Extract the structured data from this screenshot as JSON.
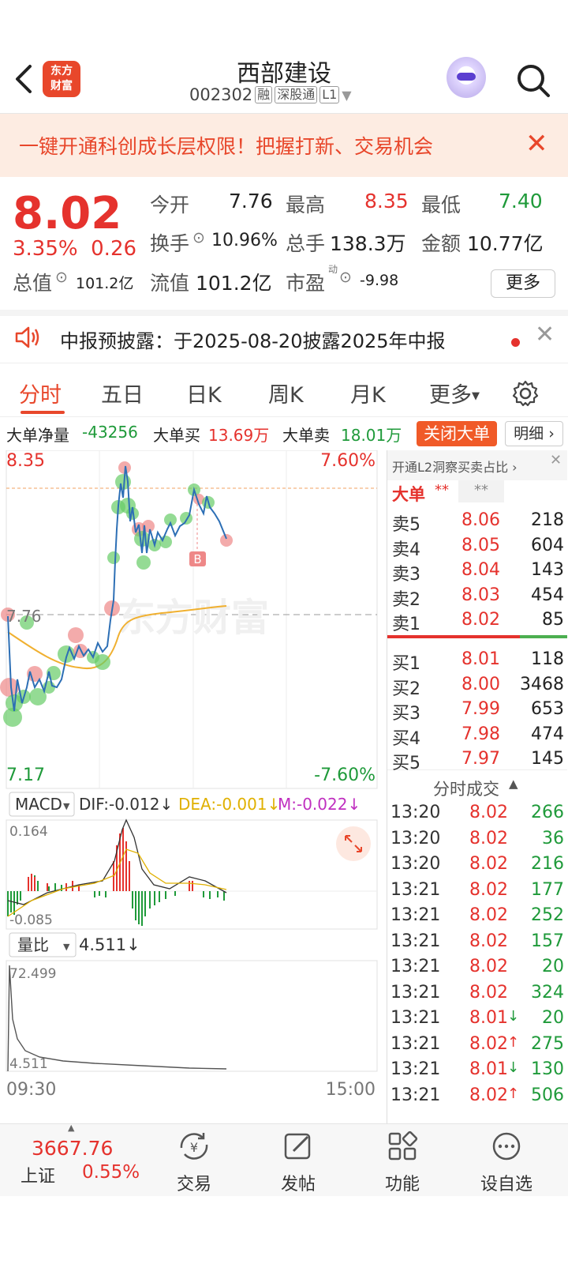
{
  "header": {
    "logo_line1": "东方",
    "logo_line2": "财富",
    "title": "西部建设",
    "code": "002302",
    "tag_rong": "融",
    "tag_sgt": "深股通",
    "tag_l1": "L1"
  },
  "banner": {
    "text": "一键开通科创成长层权限！把握打新、交易机会"
  },
  "quote": {
    "price": "8.02",
    "change_pct": "3.35%",
    "change": "0.26",
    "open_label": "今开",
    "open": "7.76",
    "high_label": "最高",
    "high": "8.35",
    "low_label": "最低",
    "low": "7.40",
    "turnover_label": "换手",
    "turnover": "10.96%",
    "volume_label": "总手",
    "volume": "138.3万",
    "amount_label": "金额",
    "amount": "10.77亿",
    "mktcap_label": "总值",
    "mktcap": "101.2亿",
    "float_label": "流值",
    "float": "101.2亿",
    "pe_label": "市盈",
    "pe_sup": "动",
    "pe": "-9.98",
    "more": "更多"
  },
  "notice": {
    "text": "中报预披露：于2025-08-20披露2025年中报"
  },
  "tabs": [
    "分时",
    "五日",
    "日K",
    "周K",
    "月K",
    "更多"
  ],
  "bigorder": {
    "net_label": "大单净量",
    "net": "-43256",
    "buy_label": "大单买",
    "buy": "13.69万",
    "sell_label": "大单卖",
    "sell": "18.01万",
    "close_btn": "关闭大单",
    "detail_btn": "明细"
  },
  "chart_labels": {
    "high": "8.35",
    "high_pct": "7.60%",
    "open": "7.76",
    "low": "7.17",
    "low_pct": "-7.60%",
    "watermark": "东方财富",
    "marker": "B",
    "time_start": "09:30",
    "time_end": "15:00"
  },
  "macd": {
    "name": "MACD",
    "dif": "DIF:-0.012↓",
    "dea": "DEA:-0.001↓",
    "m": "M:-0.022↓",
    "top": "0.164",
    "bottom": "-0.085"
  },
  "volratio": {
    "name": "量比",
    "value": "4.511↓",
    "top": "72.499",
    "bottom": "4.511"
  },
  "level2": {
    "promo": "开通L2洞察买卖占比 ›",
    "big_label": "大单",
    "stars1": "**",
    "stars2": "**"
  },
  "orderbook": {
    "asks": [
      {
        "label": "卖5",
        "price": "8.06",
        "vol": "218"
      },
      {
        "label": "卖4",
        "price": "8.05",
        "vol": "604"
      },
      {
        "label": "卖3",
        "price": "8.04",
        "vol": "143"
      },
      {
        "label": "卖2",
        "price": "8.03",
        "vol": "454"
      },
      {
        "label": "卖1",
        "price": "8.02",
        "vol": "85"
      }
    ],
    "bids": [
      {
        "label": "买1",
        "price": "8.01",
        "vol": "118"
      },
      {
        "label": "买2",
        "price": "8.00",
        "vol": "3468"
      },
      {
        "label": "买3",
        "price": "7.99",
        "vol": "653"
      },
      {
        "label": "买4",
        "price": "7.98",
        "vol": "474"
      },
      {
        "label": "买5",
        "price": "7.97",
        "vol": "145"
      }
    ]
  },
  "trades_header": "分时成交",
  "trades": [
    {
      "time": "13:20",
      "price": "8.02",
      "vol": "266",
      "dir": ""
    },
    {
      "time": "13:20",
      "price": "8.02",
      "vol": "36",
      "dir": ""
    },
    {
      "time": "13:20",
      "price": "8.02",
      "vol": "216",
      "dir": ""
    },
    {
      "time": "13:21",
      "price": "8.02",
      "vol": "177",
      "dir": ""
    },
    {
      "time": "13:21",
      "price": "8.02",
      "vol": "252",
      "dir": ""
    },
    {
      "time": "13:21",
      "price": "8.02",
      "vol": "157",
      "dir": ""
    },
    {
      "time": "13:21",
      "price": "8.02",
      "vol": "20",
      "dir": ""
    },
    {
      "time": "13:21",
      "price": "8.02",
      "vol": "324",
      "dir": ""
    },
    {
      "time": "13:21",
      "price": "8.01",
      "vol": "20",
      "dir": "↓"
    },
    {
      "time": "13:21",
      "price": "8.02",
      "vol": "275",
      "dir": "↑"
    },
    {
      "time": "13:21",
      "price": "8.01",
      "vol": "130",
      "dir": "↓"
    },
    {
      "time": "13:21",
      "price": "8.02",
      "vol": "506",
      "dir": "↑"
    }
  ],
  "bottomnav": {
    "index_value": "3667.76",
    "index_name": "上证",
    "index_pct": "0.55%",
    "trade": "交易",
    "post": "发帖",
    "func": "功能",
    "watch": "设自选"
  },
  "colors": {
    "red": "#e5322d",
    "green": "#1f9a3a",
    "accent": "#e8472b",
    "avg_line": "#f0b030",
    "price_line": "#2d6fb5"
  }
}
